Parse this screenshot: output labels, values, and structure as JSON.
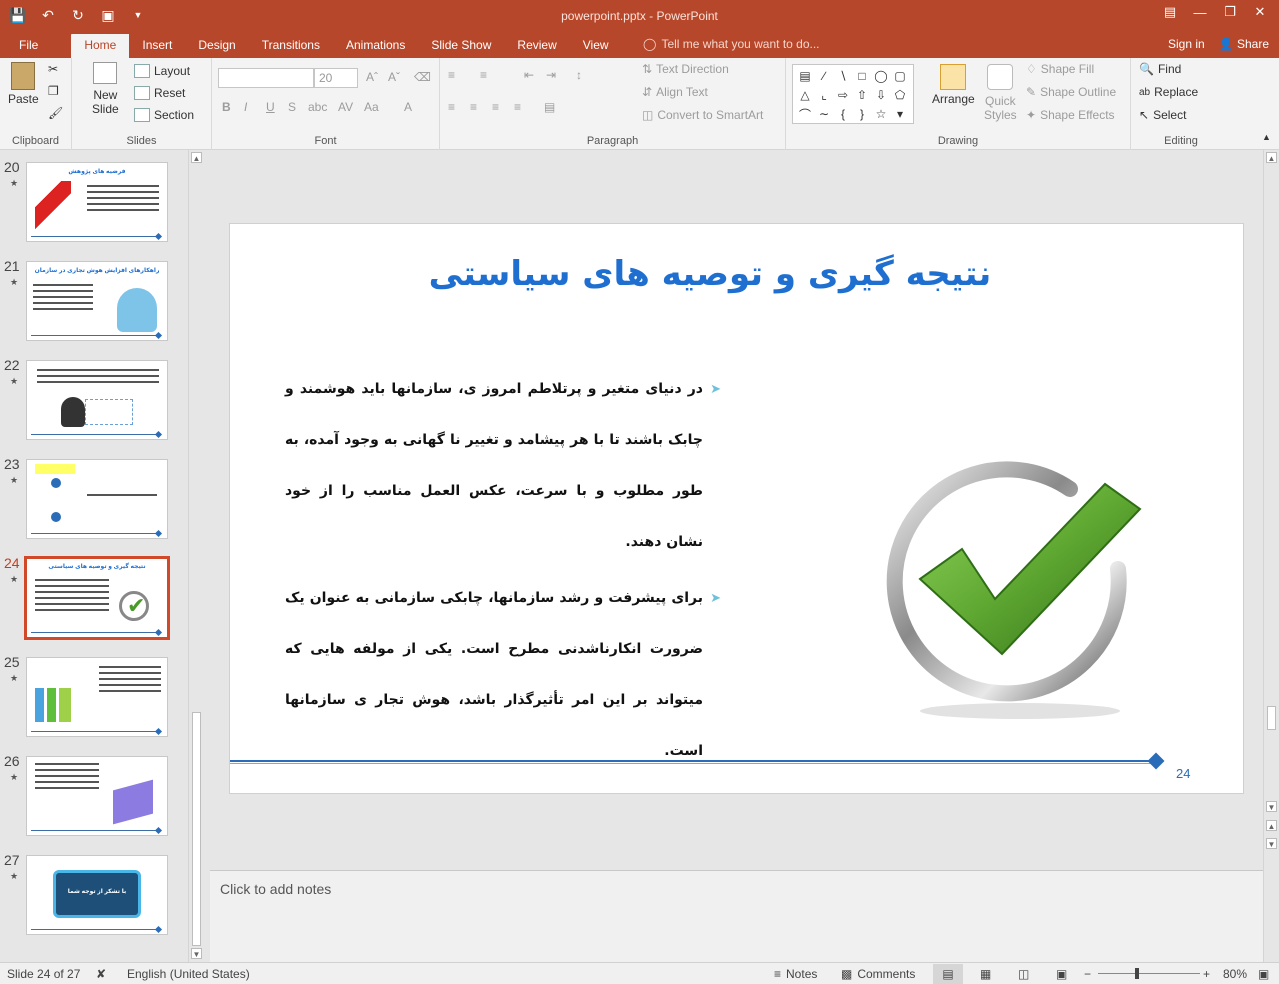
{
  "titlebar": {
    "doc_title": "powerpoint.pptx - PowerPoint"
  },
  "tabs": [
    "File",
    "Home",
    "Insert",
    "Design",
    "Transitions",
    "Animations",
    "Slide Show",
    "Review",
    "View"
  ],
  "tell_me": "Tell me what you want to do...",
  "account": {
    "signin": "Sign in",
    "share": "Share"
  },
  "ribbon": {
    "clipboard": {
      "paste": "Paste",
      "label": "Clipboard"
    },
    "slides": {
      "new_slide": "New",
      "new_slide2": "Slide",
      "layout": "Layout",
      "reset": "Reset",
      "section": "Section",
      "label": "Slides"
    },
    "font": {
      "font_size": "20",
      "label": "Font"
    },
    "paragraph": {
      "text_direction": "Text Direction",
      "align_text": "Align Text",
      "smartart": "Convert to SmartArt",
      "label": "Paragraph"
    },
    "drawing": {
      "arrange": "Arrange",
      "quick_styles": "Quick",
      "quick_styles2": "Styles",
      "shape_fill": "Shape Fill",
      "shape_outline": "Shape Outline",
      "shape_effects": "Shape Effects",
      "label": "Drawing"
    },
    "editing": {
      "find": "Find",
      "replace": "Replace",
      "select": "Select",
      "label": "Editing"
    }
  },
  "thumbnails": [
    {
      "num": "20",
      "title": "فرضیه های پژوهش"
    },
    {
      "num": "21",
      "title": "راهکارهای افزایش هوش تجاری در سازمان"
    },
    {
      "num": "22",
      "title": ""
    },
    {
      "num": "23",
      "title": ""
    },
    {
      "num": "24",
      "title": "نتیجه گیری و توصیه های سیاستی",
      "active": true
    },
    {
      "num": "25",
      "title": ""
    },
    {
      "num": "26",
      "title": ""
    },
    {
      "num": "27",
      "title": "با تشکر از توجه شما"
    }
  ],
  "slide": {
    "title": "نتیجه گیری و توصیه های سیاستی",
    "bullets": [
      "در دنیای متغیر و پرتلاطم امروز ی، سازمانها باید هوشمند و چابک باشند تا با هر پیشامد و تغییر نا گهانی به وجود آمده، به طور مطلوب و با سرعت، عکس العمل مناسب را از خود نشان دهند.",
      "برای پیشرفت و رشد سازمانها، چابکی سازمانی به عنوان یک ضرورت انکارناشدنی مطرح است. یکی از مولفه هایی که میتواند بر این امر تأثیرگذار باشد، هوش تجار ی سازمانها است."
    ],
    "number": "24"
  },
  "notes": {
    "placeholder": "Click to add notes"
  },
  "status": {
    "slide_info": "Slide 24 of 27",
    "language": "English (United States)",
    "notes": "Notes",
    "comments": "Comments",
    "zoom": "80%"
  },
  "colors": {
    "accent": "#b7472a",
    "title_blue": "#1f6fd1",
    "check_green": "#5fa832"
  }
}
